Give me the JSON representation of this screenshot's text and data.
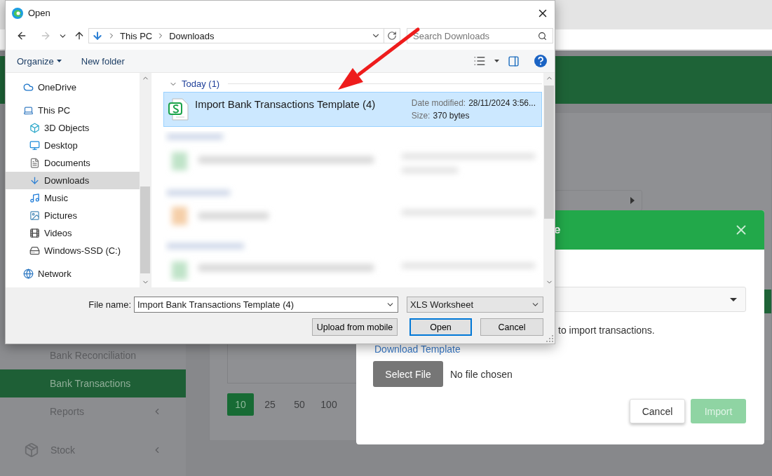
{
  "dialog": {
    "title": "Open",
    "back_disabled": false,
    "forward_disabled": true,
    "breadcrumb": [
      "This PC",
      "Downloads"
    ],
    "search": {
      "placeholder": "Search Downloads"
    },
    "commands": [
      {
        "label": "Organize",
        "kind": "menu"
      },
      {
        "label": "New folder",
        "kind": "button"
      }
    ],
    "nav_pane": [
      {
        "label": "OneDrive",
        "kind": "cloud",
        "selected": false
      },
      {
        "label": "This PC",
        "kind": "pc",
        "selected": false,
        "children": [
          {
            "label": "3D Objects",
            "kind": "cube",
            "selected": false
          },
          {
            "label": "Desktop",
            "kind": "desktop",
            "selected": false
          },
          {
            "label": "Documents",
            "kind": "document",
            "selected": false
          },
          {
            "label": "Downloads",
            "kind": "download",
            "selected": true
          },
          {
            "label": "Music",
            "kind": "music",
            "selected": false
          },
          {
            "label": "Pictures",
            "kind": "pictures",
            "selected": false
          },
          {
            "label": "Videos",
            "kind": "videos",
            "selected": false
          },
          {
            "label": "Windows-SSD (C:)",
            "kind": "drive",
            "selected": false
          }
        ]
      },
      {
        "label": "Network",
        "kind": "network",
        "selected": false
      }
    ],
    "groups": [
      {
        "label": "Today (1)",
        "expanded": true,
        "files": [
          {
            "name": "Import Bank Transactions Template (4)",
            "selected": true,
            "date_label": "Date modified:",
            "date": "28/11/2024 3:56...",
            "size_label": "Size:",
            "size": "370 bytes"
          }
        ]
      }
    ],
    "file_name": {
      "label": "File name:",
      "value": "Import Bank Transactions Template (4)"
    },
    "file_type": "XLS Worksheet",
    "buttons": [
      {
        "label": "Upload from mobile",
        "kind": "secondary"
      },
      {
        "label": "Open",
        "kind": "default"
      },
      {
        "label": "Cancel",
        "kind": "secondary"
      }
    ]
  },
  "page": {
    "sidebar": [
      {
        "label": "Bank Reconciliation",
        "kind": "sub",
        "selected": false,
        "expandable": false
      },
      {
        "label": "Bank Transactions",
        "kind": "sub",
        "selected": true,
        "expandable": false
      },
      {
        "label": "Reports",
        "kind": "sub",
        "selected": false,
        "expandable": true
      },
      {
        "label": "Stock",
        "kind": "section",
        "selected": false,
        "expandable": true
      }
    ],
    "page_sizes": [
      {
        "label": "10",
        "selected": true
      },
      {
        "label": "25",
        "selected": false
      },
      {
        "label": "50",
        "selected": false
      },
      {
        "label": "100",
        "selected": false
      }
    ]
  },
  "modal": {
    "title": "e",
    "instruction": "to import transactions.",
    "link": "Download Template",
    "select_file": "Select File",
    "file_status": "No file chosen",
    "buttons": [
      {
        "label": "Cancel",
        "kind": "secondary",
        "disabled": false
      },
      {
        "label": "Import",
        "kind": "primary",
        "disabled": true
      }
    ]
  }
}
